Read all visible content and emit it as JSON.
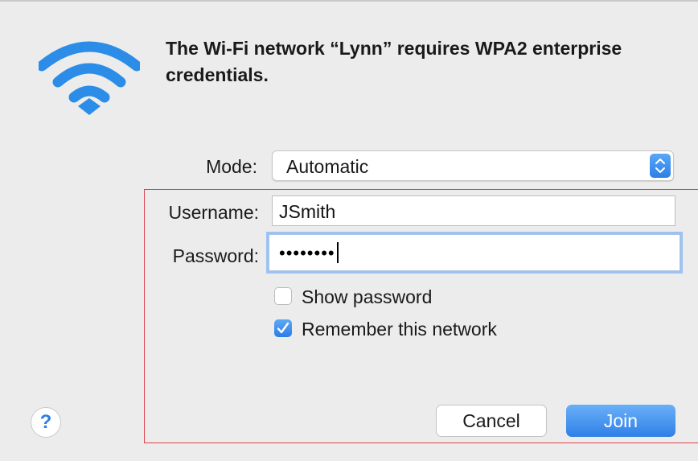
{
  "dialog": {
    "title": "The Wi-Fi network “Lynn” requires WPA2 enterprise credentials."
  },
  "form": {
    "mode_label": "Mode:",
    "mode_value": "Automatic",
    "username_label": "Username:",
    "username_value": "JSmith",
    "password_label": "Password:",
    "password_masked": "••••••••"
  },
  "options": {
    "show_password_label": "Show password",
    "show_password_checked": false,
    "remember_label": "Remember this network",
    "remember_checked": true
  },
  "buttons": {
    "help": "?",
    "cancel": "Cancel",
    "join": "Join"
  },
  "icons": {
    "app": "wifi-icon",
    "help": "question-mark-icon",
    "stepper": "chevron-up-down-icon",
    "check": "checkmark-icon"
  },
  "colors": {
    "accent": "#2f80e7",
    "wifi": "#2b8de8",
    "highlight": "#d9434b",
    "background": "#ececec"
  }
}
